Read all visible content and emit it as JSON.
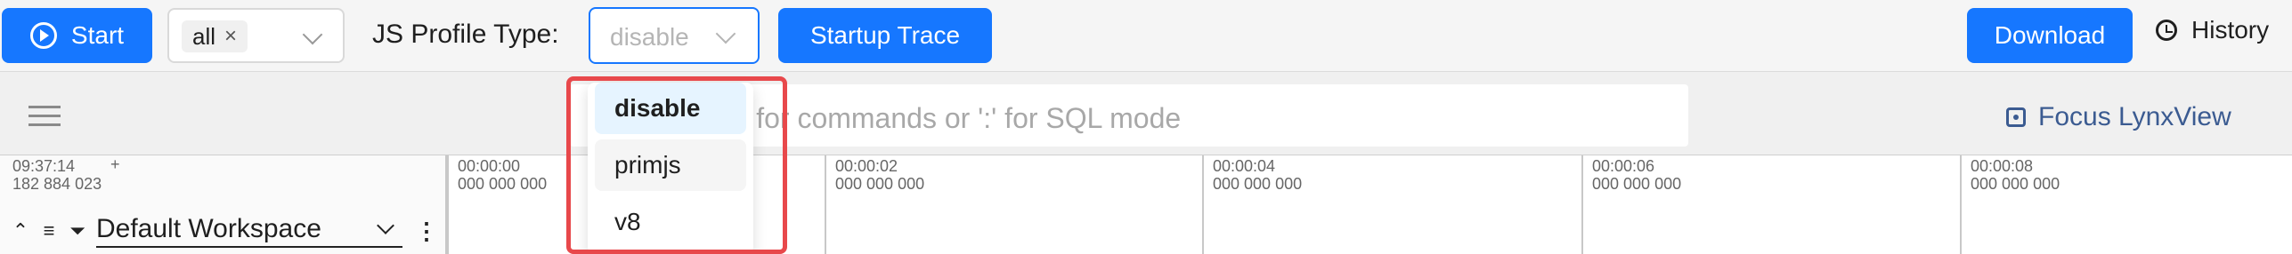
{
  "toolbar": {
    "start_label": "Start",
    "filter_tag": "all",
    "filter_tag_remove": "×",
    "js_profile_label": "JS Profile Type:",
    "js_profile_value": "disable",
    "startup_trace_label": "Startup Trace",
    "download_label": "Download",
    "history_label": "History"
  },
  "search": {
    "placeholder_visible": "ch or type '>' for commands or ':' for SQL mode",
    "focus_label": "Focus LynxView"
  },
  "timeline": {
    "cursor_time": "09:37:14",
    "cursor_ns": "182 884 023",
    "add": "+",
    "workspace": "Default Workspace",
    "ticks": [
      {
        "time": "00:00:00",
        "ns": "000 000 000"
      },
      {
        "time": "00:00:02",
        "ns": "000 000 000"
      },
      {
        "time": "00:00:04",
        "ns": "000 000 000"
      },
      {
        "time": "00:00:06",
        "ns": "000 000 000"
      },
      {
        "time": "00:00:08",
        "ns": "000 000 000"
      }
    ]
  },
  "js_profile_options": [
    "disable",
    "primjs",
    "v8"
  ],
  "colors": {
    "primary": "#1677ff",
    "highlight": "#e8484b",
    "focus": "#3b5b91"
  },
  "icons": [
    "play-icon",
    "close-icon",
    "chevron-down-icon",
    "clock-icon",
    "menu-icon",
    "focus-icon",
    "collapse-icon",
    "sort-icon",
    "filter-icon",
    "more-icon"
  ]
}
